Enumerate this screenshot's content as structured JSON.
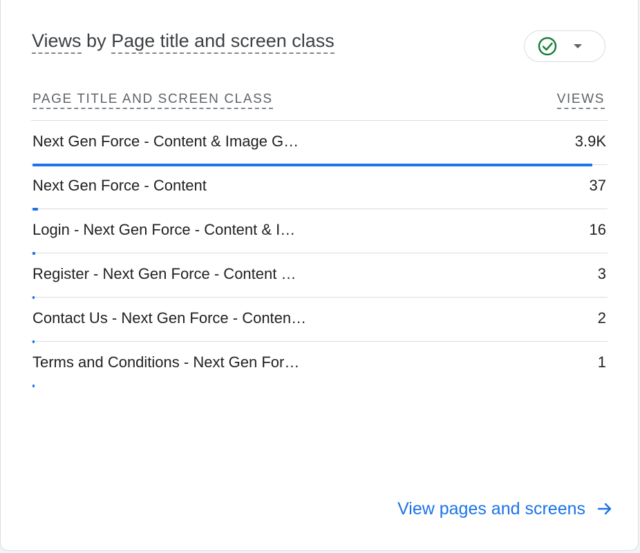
{
  "card": {
    "title": {
      "prefix": "Views",
      "by": " by ",
      "dimension": "Page title and screen class"
    },
    "status_icon": "check-circle-icon",
    "dropdown_icon": "caret-down-icon"
  },
  "table": {
    "dimension_header": "PAGE TITLE AND SCREEN CLASS",
    "metric_header": "VIEWS",
    "rows": [
      {
        "label": "Next Gen Force - Content & Image G…",
        "value": "3.9K",
        "bar_fraction": 0.985
      },
      {
        "label": "Next Gen Force - Content",
        "value": "37",
        "bar_fraction": 0.01
      },
      {
        "label": "Login - Next Gen Force - Content & I…",
        "value": "16",
        "bar_fraction": 0.005
      },
      {
        "label": "Register - Next Gen Force - Content …",
        "value": "3",
        "bar_fraction": 0.002
      },
      {
        "label": "Contact Us - Next Gen Force - Conten…",
        "value": "2",
        "bar_fraction": 0.002
      },
      {
        "label": "Terms and Conditions - Next Gen For…",
        "value": "1",
        "bar_fraction": 0.002
      }
    ]
  },
  "footer": {
    "link_label": "View pages and screens",
    "icon": "arrow-right-icon"
  },
  "colors": {
    "accent": "#1a73e8",
    "success": "#188038",
    "divider": "#dadce0"
  }
}
